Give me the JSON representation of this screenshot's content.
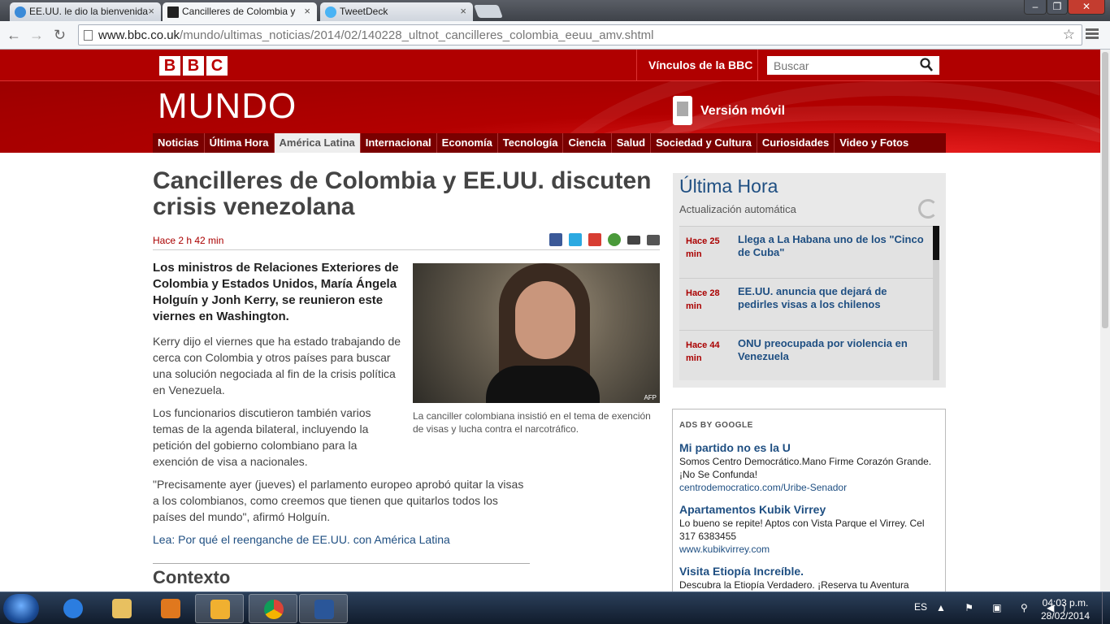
{
  "browser": {
    "tabs": [
      {
        "title": "EE.UU. le dio la bienvenida",
        "active": false
      },
      {
        "title": "Cancilleres de Colombia y",
        "active": true
      },
      {
        "title": "TweetDeck",
        "active": false
      }
    ],
    "tab_close": "×",
    "url_host": "www.bbc.co.uk",
    "url_path": "/mundo/ultimas_noticias/2014/02/140228_ultnot_cancilleres_colombia_eeuu_amv.shtml",
    "back": "←",
    "forward": "→",
    "reload": "↻",
    "star": "☆",
    "win_min": "–",
    "win_max": "❐",
    "win_close": "✕"
  },
  "bbc": {
    "logo_letters": [
      "B",
      "B",
      "C"
    ],
    "links_label": "Vínculos de la BBC",
    "search_placeholder": "Buscar",
    "mundo": "MUNDO",
    "mobile": "Versión móvil",
    "nav": [
      "Noticias",
      "Última Hora",
      "América Latina",
      "Internacional",
      "Economía",
      "Tecnología",
      "Ciencia",
      "Salud",
      "Sociedad y Cultura",
      "Curiosidades",
      "Video y Fotos"
    ],
    "nav_selected": "América Latina"
  },
  "article": {
    "headline": "Cancilleres de Colombia y EE.UU. discuten crisis venezolana",
    "timestamp": "Hace 2 h 42 min",
    "lede": "Los ministros de Relaciones Exteriores de Colombia y Estados Unidos, María Ángela Holguín y Jonh Kerry, se reunieron este viernes en Washington.",
    "p1": "Kerry dijo el viernes que ha estado trabajando de cerca con Colombia y otros países para buscar una solución negociada al fin de la crisis política en Venezuela.",
    "p2": "Los funcionarios discutieron también varios temas de la agenda bilateral, incluyendo la petición del gobierno colombiano para la exención de visa a nacionales.",
    "p3": "\"Precisamente ayer (jueves) el parlamento europeo aprobó quitar la visas a los colombianos, como creemos que tienen que quitarlos todos los países del mundo\", afirmó Holguín.",
    "read_more": "Lea: Por qué el reenganche de EE.UU. con América Latina",
    "photo_credit": "AFP",
    "caption": "La canciller colombiana insistió en el tema de exención de visas y lucha contra el narcotráfico.",
    "context_heading": "Contexto",
    "share_icons": [
      "facebook-icon",
      "twitter-icon",
      "googleplus-icon",
      "share-icon",
      "email-icon",
      "print-icon"
    ]
  },
  "ultima_hora": {
    "title": "Última Hora",
    "subtitle": "Actualización automática",
    "items": [
      {
        "time": "Hace 25 min",
        "text": "Llega a La Habana uno de los \"Cinco de Cuba\""
      },
      {
        "time": "Hace 28 min",
        "text": "EE.UU. anuncia que dejará de pedirles visas a los chilenos"
      },
      {
        "time": "Hace 44 min",
        "text": "ONU preocupada por violencia en Venezuela"
      }
    ]
  },
  "ads": {
    "label": "ADS BY GOOGLE",
    "items": [
      {
        "title": "Mi partido no es la U",
        "desc": "Somos Centro Democrático.Mano Firme Corazón Grande. ¡No Se Confunda!",
        "url": "centrodemocratico.com/Uribe-Senador"
      },
      {
        "title": "Apartamentos Kubik Virrey",
        "desc": "Lo bueno se repite! Aptos con Vista Parque el Virrey. Cel 317 6383455",
        "url": "www.kubikvirrey.com"
      },
      {
        "title": "Visita Etiopía Increíble.",
        "desc": "Descubra la Etiopía Verdadero. ¡Reserva tu Aventura",
        "url": ""
      }
    ]
  },
  "taskbar": {
    "lang": "ES",
    "tray": "▲ ⚑ ▣ ⚲ ◀)",
    "time": "04:03 p.m.",
    "date": "28/02/2014"
  },
  "colors": {
    "bbc_red": "#b00000",
    "link_blue": "#1f4f82",
    "time_red": "#a00000"
  }
}
